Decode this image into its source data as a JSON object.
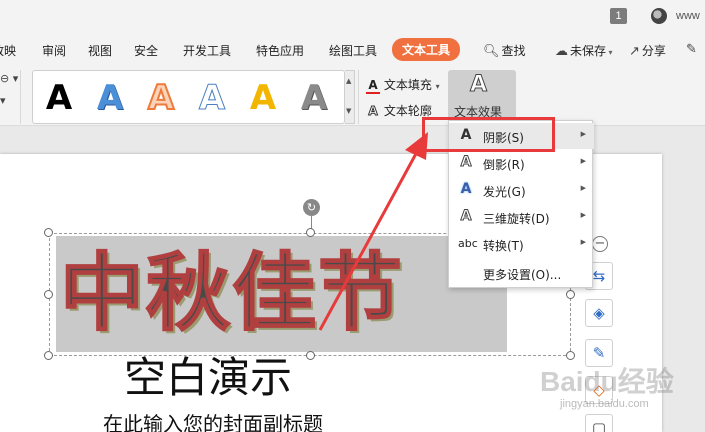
{
  "titlebar": {
    "badge": "1",
    "username": "www"
  },
  "menu": {
    "items": [
      {
        "label": "放映"
      },
      {
        "label": "审阅"
      },
      {
        "label": "视图"
      },
      {
        "label": "安全"
      },
      {
        "label": "开发工具"
      },
      {
        "label": "特色应用"
      },
      {
        "label": "绘图工具"
      },
      {
        "label": "文本工具"
      },
      {
        "label": "查找"
      }
    ],
    "unsaved": "未保存",
    "share": "分享"
  },
  "ribbon": {
    "gallery_letters": [
      "A",
      "A",
      "A",
      "A",
      "A",
      "A"
    ],
    "text_fill": "文本填充",
    "text_outline": "文本轮廓",
    "text_effect": "文本效果",
    "effect_icon_letter": "A",
    "fill_icon_letter": "A",
    "outline_icon_letter": "A"
  },
  "dropdown": {
    "items": [
      {
        "icon": "A",
        "label": "阴影(S)"
      },
      {
        "icon": "A",
        "label": "倒影(R)"
      },
      {
        "icon": "A",
        "label": "发光(G)"
      },
      {
        "icon": "A",
        "label": "三维旋转(D)"
      },
      {
        "icon": "abc",
        "label": "转换(T)"
      },
      {
        "icon": "",
        "label": "更多设置(O)..."
      }
    ]
  },
  "slide": {
    "title": "中秋佳节",
    "subtitle": "空白演示",
    "caption": "在此输入您的封面副标题"
  },
  "watermark": {
    "brand": "Baidu经验",
    "url": "jingyan.baidu.com"
  },
  "colors": {
    "accent": "#f0713f",
    "annotation": "#e83a3a"
  }
}
